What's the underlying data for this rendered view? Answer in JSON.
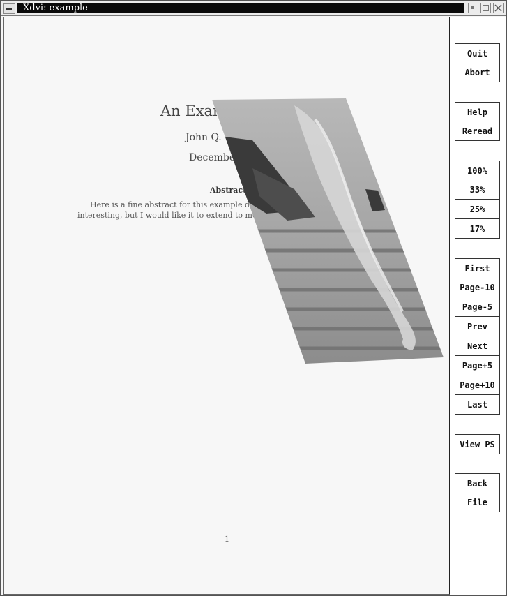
{
  "window": {
    "title": "Xdvi:  example"
  },
  "document": {
    "title_visible": "An Examp",
    "author_visible": "John Q. D",
    "date_visible": "December",
    "abstract_heading": "Abstract",
    "abstract_line1_visible": "Here is a fine abstract for this example docum",
    "abstract_line2_visible": "interesting, but I would like it to extend to more th",
    "page_number": "1"
  },
  "figure": {
    "description_icon": "tornado-photo"
  },
  "buttons": {
    "quit": "Quit",
    "abort": "Abort",
    "help": "Help",
    "reread": "Reread",
    "zoom100": "100%",
    "zoom33": "33%",
    "zoom25": "25%",
    "zoom17": "17%",
    "first": "First",
    "page_minus10": "Page-10",
    "page_minus5": "Page-5",
    "prev": "Prev",
    "next": "Next",
    "page_plus5": "Page+5",
    "page_plus10": "Page+10",
    "last": "Last",
    "view_ps": "View PS",
    "back": "Back",
    "file": "File"
  }
}
